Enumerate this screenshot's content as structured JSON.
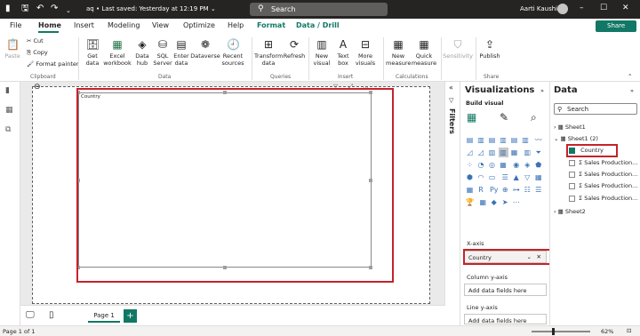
{
  "titlebar": {
    "file_name": "aq",
    "saved_status": "Last saved: Yesterday at 12:19 PM",
    "search_placeholder": "Search",
    "user_name": "Aarti Kaushik"
  },
  "menu": {
    "items": [
      "File",
      "Home",
      "Insert",
      "Modeling",
      "View",
      "Optimize",
      "Help",
      "Format",
      "Data / Drill"
    ],
    "share": "Share"
  },
  "ribbon": {
    "clipboard": {
      "paste": "Paste",
      "cut": "Cut",
      "copy": "Copy",
      "format_painter": "Format painter",
      "group": "Clipboard"
    },
    "data": {
      "get_data": "Get data",
      "excel": "Excel workbook",
      "hub": "Data hub",
      "sql": "SQL Server",
      "enter": "Enter data",
      "dataverse": "Dataverse",
      "recent": "Recent sources",
      "group": "Data"
    },
    "queries": {
      "transform": "Transform data",
      "refresh": "Refresh",
      "group": "Queries"
    },
    "insert": {
      "new_visual": "New visual",
      "text_box": "Text box",
      "more_visuals": "More visuals",
      "group": "Insert"
    },
    "calculations": {
      "new_measure": "New measure",
      "quick_measure": "Quick measure",
      "group": "Calculations"
    },
    "sensitivity": {
      "label": "Sensitivity",
      "group": ""
    },
    "share": {
      "publish": "Publish",
      "group": "Share"
    }
  },
  "canvas": {
    "visual_title": "Country"
  },
  "filters": {
    "label": "Filters"
  },
  "visualizations": {
    "title": "Visualizations",
    "build_visual": "Build visual",
    "x_axis_label": "X-axis",
    "x_axis_value": "Country",
    "column_y_label": "Column y-axis",
    "column_y_placeholder": "Add data fields here",
    "line_y_label": "Line y-axis",
    "line_y_placeholder": "Add data fields here"
  },
  "data_pane": {
    "title": "Data",
    "search_placeholder": "Search",
    "tables": [
      {
        "name": "Sheet1"
      },
      {
        "name": "Sheet1 (2)"
      },
      {
        "name": "Sheet2"
      }
    ],
    "fields": [
      "Country",
      "Sales Production...",
      "Sales Production...",
      "Sales Production...",
      "Sales Production..."
    ]
  },
  "tabs": {
    "page1": "Page 1",
    "add": "+"
  },
  "status": {
    "page": "Page 1 of 1",
    "zoom": "62%"
  },
  "colors": {
    "accent": "#117865",
    "highlight": "#c4232b",
    "titlebar": "#252423"
  }
}
